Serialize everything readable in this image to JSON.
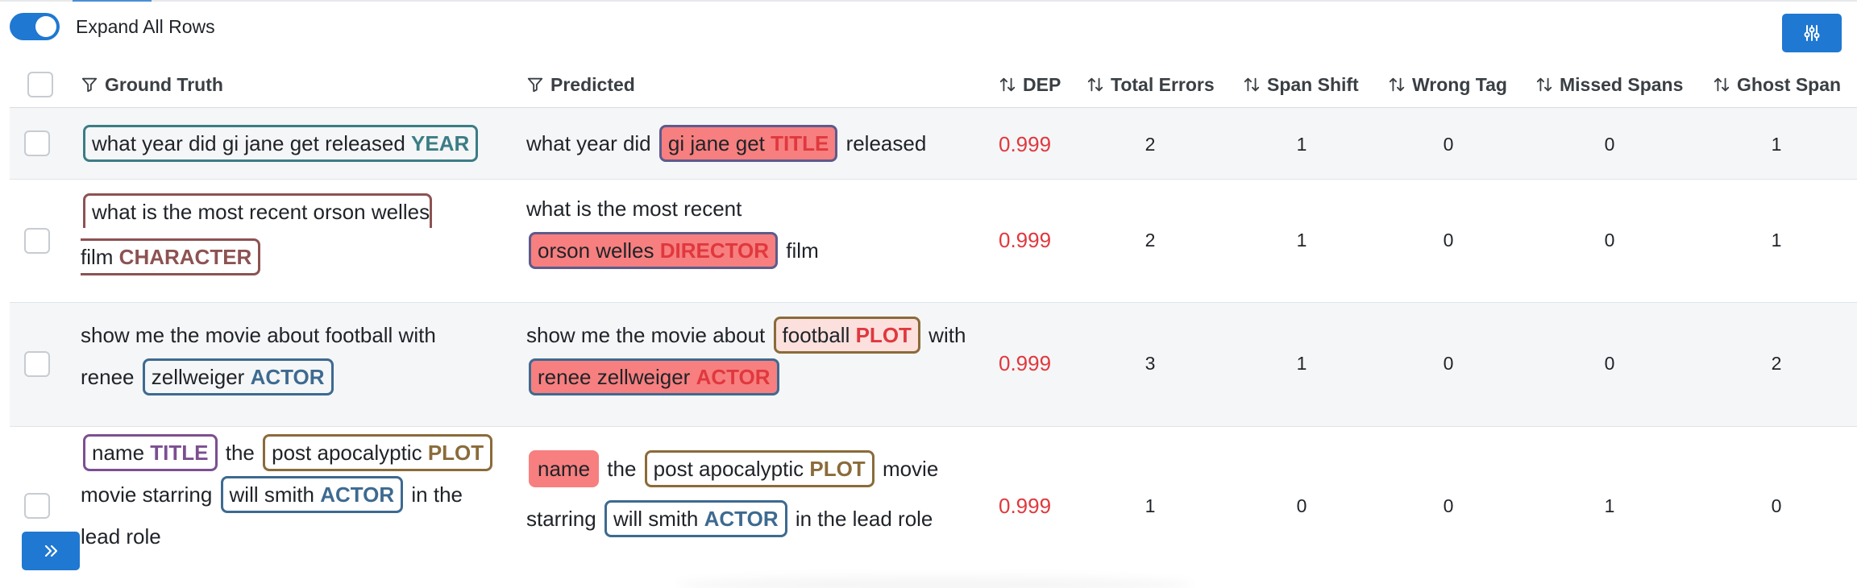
{
  "toolbar": {
    "expand_label": "Expand All Rows",
    "expand_on": true,
    "settings_icon": "sliders-icon"
  },
  "columns": {
    "ground_truth": "Ground Truth",
    "predicted": "Predicted",
    "dep": "DEP",
    "total_errors": "Total Errors",
    "span_shift": "Span Shift",
    "wrong_tag": "Wrong Tag",
    "missed_spans": "Missed Spans",
    "ghost_span": "Ghost Span"
  },
  "rows": [
    {
      "gt": {
        "span": "what year did gi jane get released",
        "tag": "YEAR"
      },
      "pred": {
        "pre": "what year did",
        "span": "gi jane get",
        "tag": "TITLE",
        "post": "released"
      },
      "dep": "0.999",
      "total_errors": "2",
      "span_shift": "1",
      "wrong_tag": "0",
      "missed_spans": "0",
      "ghost_span": "1"
    },
    {
      "gt": {
        "span_a": "what is the most recent orson welles",
        "span_b": "film",
        "tag": "CHARACTER"
      },
      "pred": {
        "pre": "what is the most recent",
        "span": "orson welles",
        "tag": "DIRECTOR",
        "post": "film"
      },
      "dep": "0.999",
      "total_errors": "2",
      "span_shift": "1",
      "wrong_tag": "0",
      "missed_spans": "0",
      "ghost_span": "1"
    },
    {
      "gt": {
        "pre": "show me the movie about football with",
        "pre2": "renee",
        "span": "zellweiger",
        "tag": "ACTOR"
      },
      "pred": {
        "pre": "show me the movie about",
        "span1": "football",
        "tag1": "PLOT",
        "mid": "with",
        "span2": "renee zellweiger",
        "tag2": "ACTOR"
      },
      "dep": "0.999",
      "total_errors": "3",
      "span_shift": "1",
      "wrong_tag": "0",
      "missed_spans": "0",
      "ghost_span": "2"
    },
    {
      "gt": {
        "span1": "name",
        "tag1": "TITLE",
        "t1": "the",
        "span2": "post apocalyptic",
        "tag2": "PLOT",
        "t2": "movie starring",
        "span3": "will smith",
        "tag3": "ACTOR",
        "t3": "in the",
        "t4": "lead role"
      },
      "pred": {
        "span1": "name",
        "t1": "the",
        "span2": "post apocalyptic",
        "tag2": "PLOT",
        "t2": "movie",
        "t3": "starring",
        "span3": "will smith",
        "tag3": "ACTOR",
        "t4": "in the lead role"
      },
      "dep": "0.999",
      "total_errors": "1",
      "span_shift": "0",
      "wrong_tag": "0",
      "missed_spans": "1",
      "ghost_span": "0"
    }
  ],
  "colors": {
    "primary": "#1f78d1",
    "error_text": "#e0383e",
    "error_fill": "#f77f7f"
  }
}
